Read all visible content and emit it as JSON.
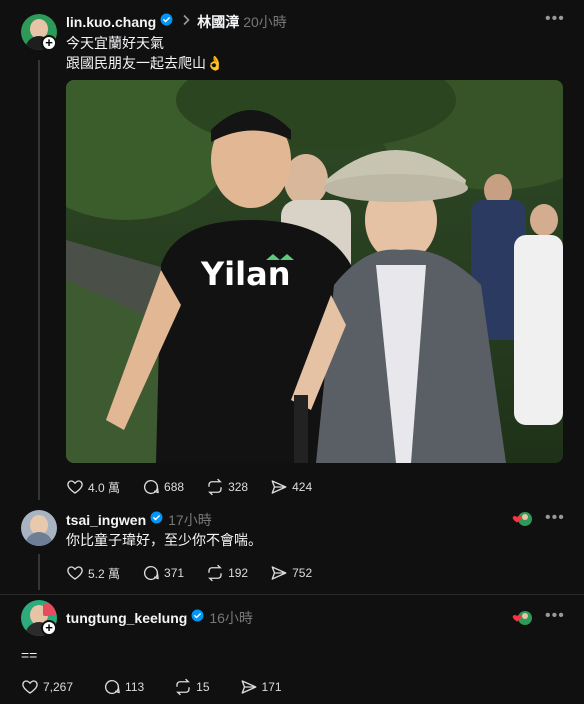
{
  "post": {
    "author": "lin.kuo.chang",
    "tag_name": "林國漳",
    "time": "20小時",
    "line1": "今天宜蘭好天氣",
    "line2": "跟國民朋友一起去爬山",
    "emoji": "👌",
    "photo_shirt_text": "Yilan",
    "likes": "4.0 萬",
    "comments": "688",
    "reposts": "328",
    "shares": "424"
  },
  "reply1": {
    "author": "tsai_ingwen",
    "time": "17小時",
    "text": "你比童子瑋好，至少你不會喘。",
    "likes": "5.2 萬",
    "comments": "371",
    "reposts": "192",
    "shares": "752"
  },
  "reply2": {
    "author": "tungtung_keelung",
    "time": "16小時",
    "text": "==",
    "likes": "7,267",
    "comments": "113",
    "reposts": "15",
    "shares": "171"
  },
  "icons": {
    "more": "more-icon",
    "verified": "verified-badge-icon",
    "like": "heart-icon",
    "comment": "comment-icon",
    "repost": "repost-icon",
    "share": "share-icon"
  },
  "colors": {
    "background": "#101010",
    "verified": "#0095f6",
    "muted": "#777777"
  }
}
